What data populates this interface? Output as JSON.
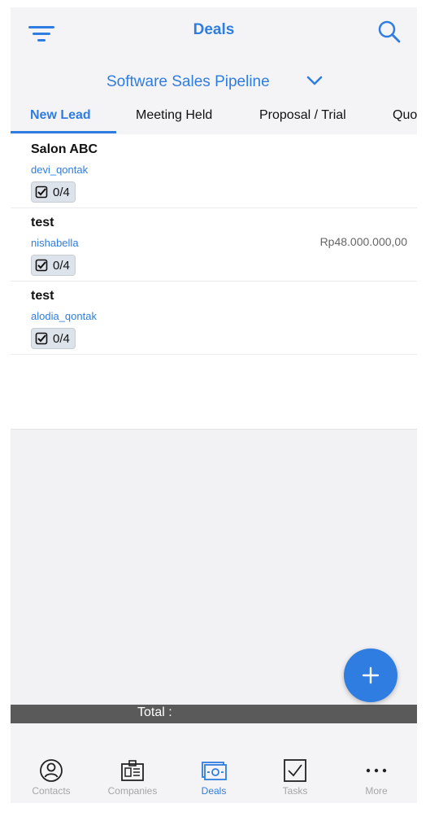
{
  "header": {
    "title": "Deals",
    "filter_icon": "filter-icon",
    "search_icon": "search-icon"
  },
  "pipeline": {
    "name": "Software Sales Pipeline",
    "icon": "chevron-down-icon"
  },
  "tabs": [
    {
      "label": "New Lead",
      "active": true
    },
    {
      "label": "Meeting Held",
      "active": false
    },
    {
      "label": "Proposal / Trial",
      "active": false
    },
    {
      "label": "Quo",
      "active": false
    }
  ],
  "deals": [
    {
      "title": "Salon ABC",
      "owner": "devi_qontak",
      "amount": "",
      "tasks": "0/4"
    },
    {
      "title": "test",
      "owner": "nishabella",
      "amount": "Rp48.000.000,00",
      "tasks": "0/4"
    },
    {
      "title": "test",
      "owner": "alodia_qontak",
      "amount": "",
      "tasks": "0/4"
    }
  ],
  "total": {
    "label": "Total :"
  },
  "fab": {
    "icon": "plus-icon"
  },
  "nav": [
    {
      "label": "Contacts",
      "icon": "contacts-icon",
      "active": false
    },
    {
      "label": "Companies",
      "icon": "companies-icon",
      "active": false
    },
    {
      "label": "Deals",
      "icon": "deals-icon",
      "active": true
    },
    {
      "label": "Tasks",
      "icon": "tasks-icon",
      "active": false
    },
    {
      "label": "More",
      "icon": "more-icon",
      "active": false
    }
  ],
  "colors": {
    "accent": "#2f7de1",
    "total_bar": "#5a5a5a"
  }
}
